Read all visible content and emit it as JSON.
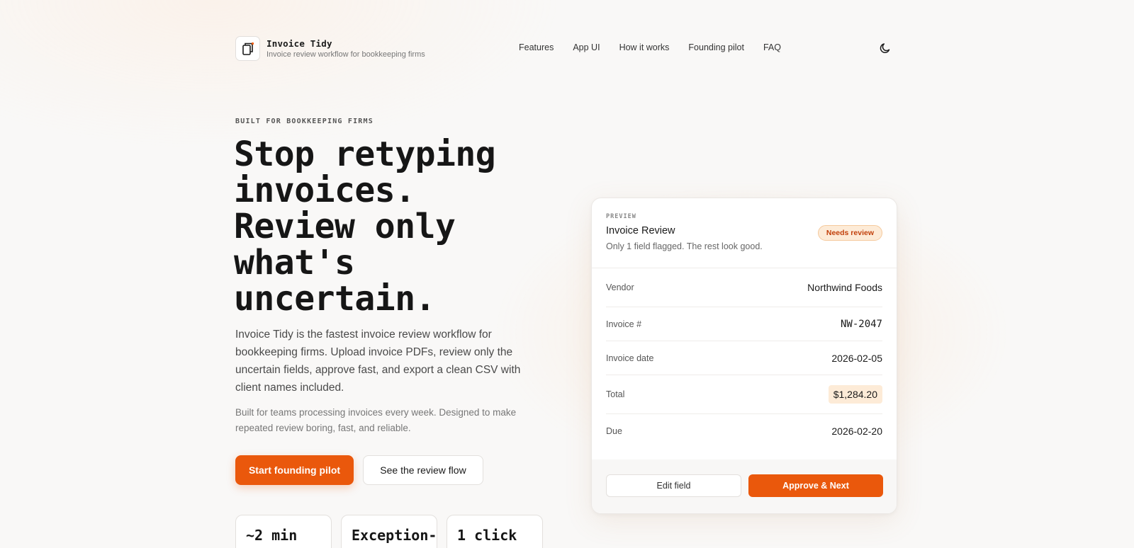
{
  "header": {
    "app_name": "Invoice Tidy",
    "tagline": "Invoice review workflow for bookkeeping firms",
    "nav": [
      "Features",
      "App UI",
      "How it works",
      "Founding pilot",
      "FAQ"
    ],
    "theme_icon": "moon-icon"
  },
  "hero": {
    "eyebrow": "BUILT FOR BOOKKEEPING FIRMS",
    "title_lines": [
      "Stop retyping",
      "invoices.",
      "Review only",
      "what's",
      "uncertain."
    ],
    "description": "Invoice Tidy is the fastest invoice review workflow for bookkeeping firms. Upload invoice PDFs, review only the uncertain fields, approve fast, and export a clean CSV with client names included.",
    "subtext": "Built for teams processing invoices every week. Designed to make repeated review boring, fast, and reliable.",
    "primary_cta": "Start founding pilot",
    "secondary_cta": "See the review flow",
    "stats": [
      "~2 min",
      "Exception-",
      "1 click"
    ]
  },
  "preview_card": {
    "eyebrow": "PREVIEW",
    "title": "Invoice Review",
    "note": "Only 1 field flagged. The rest look good.",
    "badge": "Needs review",
    "fields": [
      {
        "label": "Vendor",
        "value": "Northwind Foods"
      },
      {
        "label": "Invoice #",
        "value": "NW-2047"
      },
      {
        "label": "Invoice date",
        "value": "2026-02-05"
      },
      {
        "label": "Total",
        "value": "$1,284.20",
        "flagged": true
      },
      {
        "label": "Due",
        "value": "2026-02-20"
      }
    ],
    "edit_button": "Edit field",
    "approve_button": "Approve & Next"
  },
  "colors": {
    "accent": "#ea580c",
    "badge_bg": "#fdebd7",
    "badge_text": "#c2410c",
    "background": "#f9f8f7"
  }
}
